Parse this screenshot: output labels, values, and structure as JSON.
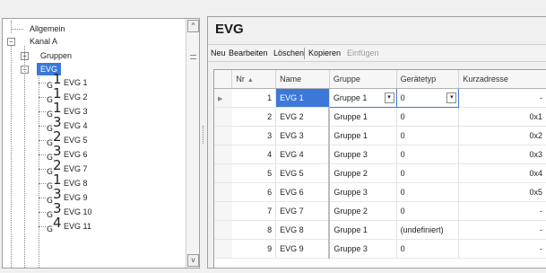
{
  "tree": {
    "items": [
      {
        "label": "Allgemein",
        "level": 1,
        "expander": ""
      },
      {
        "label": "Kanal A",
        "level": 0,
        "expander": "−"
      },
      {
        "label": "Gruppen",
        "level": 2,
        "expander": "+"
      },
      {
        "label": "EVG",
        "level": 2,
        "expander": "−",
        "selected": true
      }
    ],
    "devices": [
      {
        "group": "1",
        "label": "EVG 1"
      },
      {
        "group": "1",
        "label": "EVG 2"
      },
      {
        "group": "1",
        "label": "EVG 3"
      },
      {
        "group": "3",
        "label": "EVG 4"
      },
      {
        "group": "2",
        "label": "EVG 5"
      },
      {
        "group": "3",
        "label": "EVG 6"
      },
      {
        "group": "2",
        "label": "EVG 7"
      },
      {
        "group": "1",
        "label": "EVG 8"
      },
      {
        "group": "3",
        "label": "EVG 9"
      },
      {
        "group": "3",
        "label": "EVG 10"
      },
      {
        "group": "4",
        "label": "EVG 11"
      }
    ],
    "group_prefix": "G",
    "scroll_up_icon": "^",
    "scroll_down_icon": "v"
  },
  "main": {
    "title": "EVG",
    "toolbar": {
      "new": "Neu",
      "edit": "Bearbeiten",
      "delete": "Löschen",
      "copy": "Kopieren",
      "paste": "Einfügen"
    },
    "table": {
      "columns": [
        "Nr",
        "Name",
        "Gruppe",
        "Gerätetyp",
        "Kurzadresse"
      ],
      "rows": [
        {
          "nr": "1",
          "name": "EVG 1",
          "gruppe": "Gruppe 1",
          "typ": "0",
          "kurz": "-"
        },
        {
          "nr": "2",
          "name": "EVG 2",
          "gruppe": "Gruppe 1",
          "typ": "0",
          "kurz": "0x1"
        },
        {
          "nr": "3",
          "name": "EVG 3",
          "gruppe": "Gruppe 1",
          "typ": "0",
          "kurz": "0x2"
        },
        {
          "nr": "4",
          "name": "EVG 4",
          "gruppe": "Gruppe 3",
          "typ": "0",
          "kurz": "0x3"
        },
        {
          "nr": "5",
          "name": "EVG 5",
          "gruppe": "Gruppe 2",
          "typ": "0",
          "kurz": "0x4"
        },
        {
          "nr": "6",
          "name": "EVG 6",
          "gruppe": "Gruppe 3",
          "typ": "0",
          "kurz": "0x5"
        },
        {
          "nr": "7",
          "name": "EVG 7",
          "gruppe": "Gruppe 2",
          "typ": "0",
          "kurz": "-"
        },
        {
          "nr": "8",
          "name": "EVG 8",
          "gruppe": "Gruppe 1",
          "typ": "(undefiniert)",
          "kurz": "-"
        },
        {
          "nr": "9",
          "name": "EVG 9",
          "gruppe": "Gruppe 3",
          "typ": "0",
          "kurz": "-"
        }
      ]
    }
  },
  "colors": {
    "selection": "#3b78d8"
  }
}
